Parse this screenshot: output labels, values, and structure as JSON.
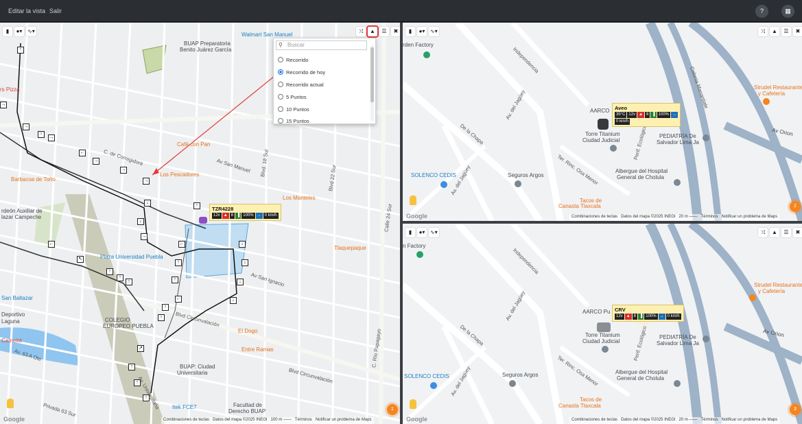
{
  "topbar": {
    "edit_view": "Editar la vista",
    "logout": "Salir",
    "help_icon": "?",
    "apps_icon": "grid"
  },
  "toolbar": {
    "layers_icon": "layers-icon",
    "pin_label": "▾",
    "route_label": "∿▾",
    "shuffle_icon": "⤨",
    "road_icon": "▲",
    "list_icon": "☰",
    "trash_icon": "✖"
  },
  "dropdown": {
    "search_placeholder": "Buscar",
    "options": [
      {
        "label": "Recorrido",
        "selected": false
      },
      {
        "label": "Recorrido de hoy",
        "selected": true
      },
      {
        "label": "Recorrido actual",
        "selected": false
      },
      {
        "label": "5 Puntos",
        "selected": false
      },
      {
        "label": "10 Puntos",
        "selected": false
      },
      {
        "label": "15 Puntos",
        "selected": false
      }
    ]
  },
  "map_left": {
    "labels": {
      "walmart": "Walmart San Manuel",
      "buap_prep": "BUAP Preparatoria",
      "benito": "Benito Juárez García",
      "cafe_pan": "Café con Pan",
      "pescadores": "Los Pescadores",
      "barbacoa": "Barbacoa de Toño",
      "manteles": "Los Manteles",
      "tlaquepaque": "Tlaquepaque",
      "plaza": "Plaza Universidad Puebla",
      "baltazar": "San Baltazar",
      "colegio": "COLEGIO",
      "europeo": "EUROPEO PUEBLA",
      "dogo": "El Dogo",
      "entre": "Entre Ramas",
      "buap_ciudad": "BUAP: Ciudad",
      "universitaria": "Universitaria",
      "facultad": "Facultad de",
      "derecho": "Derecho BUAP",
      "itek": "Itek FCE7",
      "rs_pizza": "rs Pizza",
      "av_san_manuel": "Av San Manuel",
      "corregidora": "C. de Corregidora",
      "av_san_ignacio": "Av San Ignacio",
      "blvd_circ": "Blvd Circunvalación",
      "blvd_18": "Blvd. 18 Sur",
      "blvd_22": "Blvd 22 Sur",
      "calle_24": "Calle 24 Sur",
      "av_universitaria": "Av. Universitaria",
      "rio_papagayo": "C. Río Papagayo",
      "av_63": "Av. 63 A Ote",
      "privada": "Privada 63 Sur",
      "camelot": "Camelot",
      "deportivo": "Deportivo",
      "laguna": "Laguna",
      "auxiliar": "rdeón Auxiliar de",
      "campeche": "lazar Campeche"
    },
    "vehicle": {
      "name": "TZR4228",
      "chips": [
        "12v",
        "▲",
        "8",
        "▐",
        "100%",
        "→",
        "0 km/h"
      ]
    },
    "cluster": "1",
    "footer": {
      "shortcuts": "Combinaciones de teclas",
      "data": "Datos del mapa ©2025 INEGI",
      "scale": "100 m",
      "terms": "Términos",
      "report": "Notificar un problema de Maps"
    },
    "google": "Google"
  },
  "map_tr": {
    "labels": {
      "garden": "rden Factory",
      "independencia": "Independencia",
      "jaguey": "Av. del Jagüey",
      "la_chapa": "De la Chapa",
      "arco": "AARCO",
      "torre": "Torre Titanium",
      "ciudad_judicial": "Ciudad Judicial",
      "pediatria": "PEDIATRÍA De",
      "salvador": "Salvador Lima Ja",
      "solenco": "SOLENCO CEDIS",
      "seguros": "Seguros Argos",
      "albergue": "Albergue del Hospital",
      "general": "General de Cholula",
      "strudel": "Strudel Restaurante",
      "cafeteria": "y Cafetería",
      "av_orion": "Av Orion",
      "tacos": "Tacos de",
      "canasta": "Canasta Tlaxcala",
      "ter_rinc": "Ter. Rinc. Osa Menor",
      "perif": "Perif. Ecológico",
      "colonia": "Colonia Manantiale"
    },
    "vehicle": {
      "name": "Aveo",
      "chips": [
        "35°C",
        "12v",
        "▲",
        "8",
        "▐",
        "100%",
        "→"
      ],
      "speed": "0 km/h"
    },
    "cluster": "2",
    "footer": {
      "shortcuts": "Combinaciones de teclas",
      "data": "Datos del mapa ©2025 INEGI",
      "scale": "20 m",
      "terms": "Términos",
      "report": "Notificar un problema de Maps"
    },
    "google": "Google"
  },
  "map_br": {
    "labels": {
      "factory": "n Factory",
      "independencia": "Independencia",
      "jaguey": "Av. del Jagüey",
      "la_chapa": "De la Chapa",
      "arco": "AARCO Pu",
      "torre": "Torre Titanium",
      "ciudad_judicial": "Ciudad Judicial",
      "pediatria": "PEDIATRÍA De",
      "salvador": "Salvador Lima Ja",
      "solenco": "SOLENCO CEDIS",
      "seguros": "Seguros Argos",
      "albergue": "Albergue del Hospital",
      "general": "General de Cholula",
      "strudel": "Strudel Restaurante",
      "cafeteria": "y Cafetería",
      "av_orion": "Av Orion",
      "tacos": "Tacos de",
      "canasta": "Canasta Tlaxcala",
      "ter_rinc": "Ter. Rinc. Osa Menor",
      "perif": "Perif. Ecológico"
    },
    "vehicle": {
      "name": "CRV",
      "chips": [
        "12v",
        "▲",
        "8",
        "▐",
        "100%",
        "→",
        "0 km/h"
      ]
    },
    "cluster": "3",
    "footer": {
      "shortcuts": "Combinaciones de teclas",
      "data": "Datos del mapa ©2025 INEGI",
      "scale": "20 m",
      "terms": "Términos",
      "report": "Notificar un problema de Maps"
    },
    "google": "Google"
  }
}
